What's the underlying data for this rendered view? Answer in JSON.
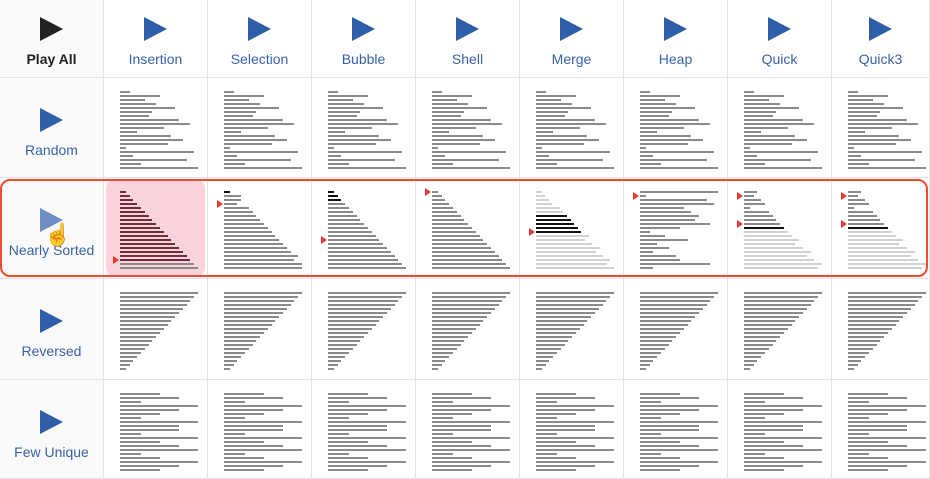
{
  "header": {
    "play_all": "Play All",
    "algorithms": [
      "Insertion",
      "Selection",
      "Bubble",
      "Shell",
      "Merge",
      "Heap",
      "Quick",
      "Quick3"
    ]
  },
  "rows": [
    {
      "label": "Random",
      "cells": "random"
    },
    {
      "label": "Nearly Sorted",
      "cells": "nearly",
      "selected": true
    },
    {
      "label": "Reversed",
      "cells": "reversed"
    },
    {
      "label": "Few Unique",
      "cells": "few"
    }
  ],
  "colors": {
    "accent": "#2f5ea8",
    "selection_border": "#f0492e",
    "highlight": "#fbd3db",
    "marker": "#e8392c"
  },
  "initial": {
    "random": [
      2,
      10,
      6,
      9,
      14,
      8,
      7,
      15,
      18,
      11,
      4,
      13,
      16,
      12,
      1,
      19,
      3,
      17,
      5,
      20
    ],
    "reversed": [
      20,
      19,
      18,
      17,
      16,
      15,
      14,
      13,
      12,
      11,
      10,
      9,
      8,
      7,
      6,
      5,
      4,
      3,
      2,
      1
    ],
    "few": [
      10,
      15,
      5,
      20,
      15,
      10,
      5,
      20,
      15,
      15,
      5,
      20,
      10,
      15,
      20,
      5,
      10,
      20,
      15,
      10
    ]
  },
  "nearly": [
    {
      "values": [
        1,
        2,
        3,
        4,
        5,
        6,
        7,
        8,
        9,
        10,
        11,
        12,
        13,
        14,
        15,
        16,
        17,
        18,
        19,
        20
      ],
      "states": "hhhhhhhhhhhhhhhhhhll",
      "markers": [
        17
      ],
      "highlight": true
    },
    {
      "values": [
        1,
        4,
        4,
        3,
        6,
        7,
        8,
        9,
        10,
        11,
        12,
        13,
        14,
        15,
        16,
        17,
        19,
        18,
        20,
        20
      ],
      "states": "annnnnnnnnnnnnnnnnnn",
      "markers": [
        3
      ]
    },
    {
      "values": [
        1,
        2,
        3,
        4,
        5,
        6,
        7,
        8,
        9,
        10,
        11,
        12,
        13,
        14,
        15,
        16,
        17,
        18,
        19,
        20
      ],
      "states": "aaannnnnnnnnnnnnnnnn",
      "markers": [
        12
      ]
    },
    {
      "values": [
        1,
        2,
        3,
        4,
        5,
        6,
        7,
        8,
        9,
        10,
        11,
        12,
        13,
        14,
        15,
        16,
        17,
        18,
        19,
        20
      ],
      "states": "nnnnnnnnnnnnnnnnnnnn",
      "markers": [
        0
      ]
    },
    {
      "values": [
        1,
        2,
        3,
        4,
        6,
        7,
        8,
        9,
        10,
        11,
        12,
        14,
        13,
        15,
        17,
        16,
        18,
        20,
        19,
        21
      ],
      "states": "ddddddaaaaaddddddddd",
      "markers": [
        10
      ]
    },
    {
      "values": [
        20,
        1,
        17,
        19,
        11,
        13,
        15,
        14,
        18,
        10,
        2,
        6,
        12,
        4,
        7,
        3,
        9,
        10,
        18,
        3
      ],
      "states": "nnnnnnnnnnnnnnnnnnnn",
      "markers": [
        1
      ]
    },
    {
      "values": [
        3,
        2,
        4,
        5,
        1,
        6,
        7,
        8,
        9,
        10,
        11,
        12,
        14,
        13,
        15,
        17,
        16,
        18,
        20,
        19
      ],
      "states": "nnnnnnnnnaddddddddddd",
      "markers": [
        1,
        8
      ]
    },
    {
      "values": [
        3,
        2,
        4,
        5,
        1,
        6,
        7,
        8,
        9,
        10,
        11,
        12,
        14,
        13,
        15,
        17,
        16,
        18,
        20,
        19
      ],
      "states": "nnnnnnnnnaddddddddddd",
      "markers": [
        1,
        8
      ]
    }
  ]
}
